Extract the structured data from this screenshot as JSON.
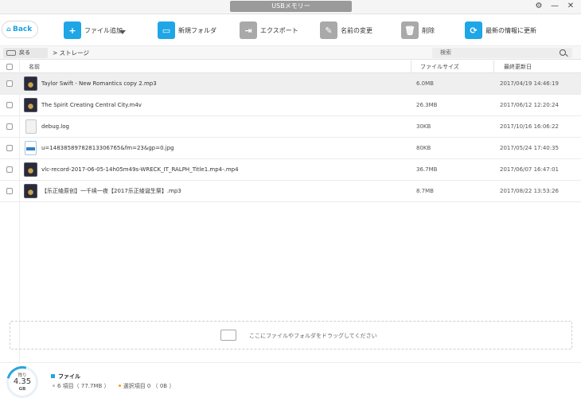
{
  "window": {
    "title": "USBメモリー",
    "settings_icon": "gear-icon",
    "minimize_icon": "minus-icon",
    "close_icon": "close-icon"
  },
  "toolbar": {
    "back_label": "Back",
    "add_file_label": "ファイル追加",
    "new_folder_label": "新規フォルダ",
    "export_label": "エクスポート",
    "rename_label": "名前の変更",
    "delete_label": "削除",
    "refresh_label": "最新の情報に更新"
  },
  "nav": {
    "back_label": "戻る",
    "breadcrumb": "> ストレージ",
    "search_placeholder": "検索"
  },
  "table": {
    "columns": {
      "name": "名前",
      "size": "ファイルサイズ",
      "date": "最終更新日"
    },
    "rows": [
      {
        "icon": "media-file-icon",
        "name": "Taylor Swift - New Romantics copy 2.mp3",
        "size": "6.0MB",
        "date": "2017/04/19 14:46:19"
      },
      {
        "icon": "media-file-icon",
        "name": "The Spirit Creating Central City.m4v",
        "size": "26.3MB",
        "date": "2017/06/12 12:20:24"
      },
      {
        "icon": "text-file-icon",
        "name": "debug.log",
        "size": "30KB",
        "date": "2017/10/16 16:06:22"
      },
      {
        "icon": "image-file-icon",
        "name": "u=1483858978281330676​5&fm=23&gp=0.jpg",
        "size": "80KB",
        "date": "2017/05/24 17:40:35"
      },
      {
        "icon": "media-file-icon",
        "name": "vlc-record-2017-06-05-14h05m49s-WRECK_IT_RALPH_Title1.mp4-.mp4",
        "size": "36.7MB",
        "date": "2017/06/07 16:47:01"
      },
      {
        "icon": "media-file-icon",
        "name": "【乐正绫原创】一千续一夜【2017乐正绫诞生祭】.mp3",
        "size": "8.7MB",
        "date": "2017/08/22 13:53:26"
      }
    ]
  },
  "dropzone": {
    "text": "ここにファイルやフォルダをドラッグしてください"
  },
  "footer": {
    "gauge_caption": "残り",
    "gauge_value": "4.35",
    "gauge_unit": "GB",
    "category": "ファイル",
    "items_text": "6 項目（ 77.7MB ）",
    "selected_text": "選択項目 0 （ 0B ）"
  },
  "colors": {
    "accent": "#1ea6e6",
    "selected_dot": "#f0a020"
  }
}
